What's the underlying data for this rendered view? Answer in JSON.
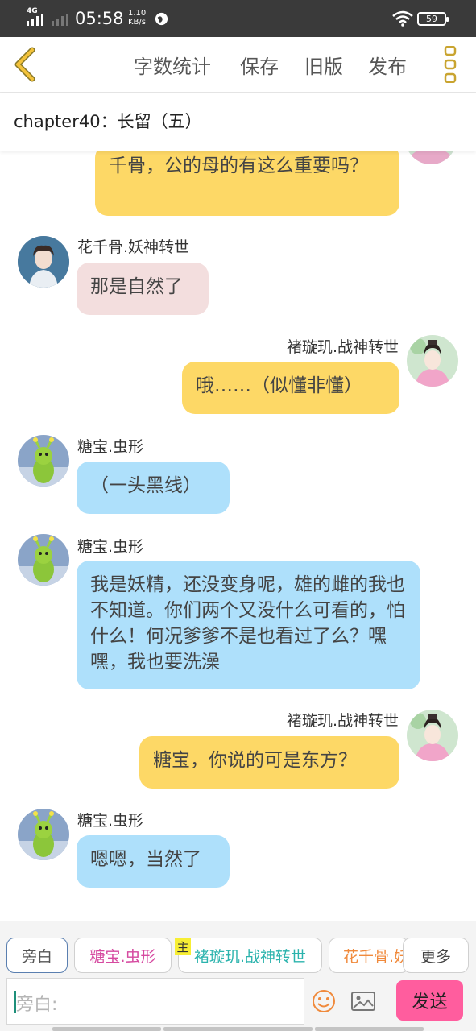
{
  "status_bar": {
    "network": "4G",
    "time": "05:58",
    "speed_value": "1.10",
    "speed_unit": "KB/s",
    "battery": "59",
    "icons": [
      "signal-icon",
      "signal-weak-icon",
      "globe-icon",
      "wifi-icon",
      "battery-icon"
    ]
  },
  "toolbar": {
    "word_count": "字数统计",
    "save": "保存",
    "old_version": "旧版",
    "publish": "发布",
    "icons": [
      "back-arrow-icon",
      "more-dots-icon"
    ],
    "accent_color": "#f3c23a"
  },
  "chapter": {
    "title": "chapter40：长留（五）"
  },
  "messages": [
    {
      "side": "right",
      "name": "",
      "text": "千骨，公的母的有这么重要吗？",
      "color": "#fdd866"
    },
    {
      "side": "left",
      "name": "花千骨.妖神转世",
      "text": "那是自然了",
      "color": "#f3dede"
    },
    {
      "side": "right",
      "name": "褚璇玑.战神转世",
      "text": "哦……（似懂非懂）",
      "color": "#fdd866"
    },
    {
      "side": "left",
      "name": "糖宝.虫形",
      "text": "（一头黑线）",
      "color": "#aee0fb"
    },
    {
      "side": "left",
      "name": "糖宝.虫形",
      "text": "我是妖精，还没变身呢，雄的雌的我也不知道。你们两个又没什么可看的，怕什么！何况爹爹不是也看过了么？嘿嘿，我也要洗澡",
      "color": "#aee0fb"
    },
    {
      "side": "right",
      "name": "褚璇玑.战神转世",
      "text": "糖宝，你说的可是东方？",
      "color": "#fdd866"
    },
    {
      "side": "left",
      "name": "糖宝.虫形",
      "text": "嗯嗯，当然了",
      "color": "#aee0fb"
    }
  ],
  "roles": {
    "narrator": "旁白",
    "tangbao": "糖宝.虫形",
    "main_badge": "主",
    "xuanji": "褚璇玑.战神转世",
    "huaqiangu": "花千骨.妖神转世",
    "more": "更多"
  },
  "composer": {
    "placeholder": "旁白:",
    "send": "发送",
    "icons": [
      "emoji-icon",
      "image-icon"
    ]
  }
}
